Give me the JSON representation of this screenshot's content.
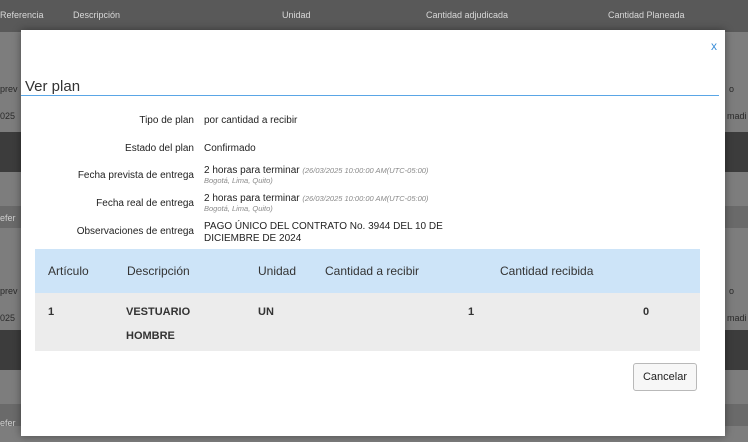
{
  "background": {
    "headers": [
      "Referencia",
      "Descripción",
      "Unidad",
      "Cantidad adjudicada",
      "Cantidad Planeada"
    ],
    "side_left": [
      "prev",
      "025",
      "efer",
      "prev",
      "025",
      "efer"
    ],
    "side_right": [
      "o",
      "madi",
      "o",
      "madi"
    ]
  },
  "modal": {
    "close_label": "x",
    "title": "Ver plan",
    "fields": {
      "plan_type": {
        "label": "Tipo de plan",
        "value": "por cantidad a recibir"
      },
      "plan_state": {
        "label": "Estado del plan",
        "value": "Confirmado"
      },
      "planned_date": {
        "label": "Fecha prevista de entrega",
        "value": "2 horas para terminar",
        "detail": "(26/03/2025 10:00:00 AM(UTC-05:00)",
        "detail2": "Bogotá, Lima, Quito)"
      },
      "real_date": {
        "label": "Fecha real de entrega",
        "value": "2 horas para terminar",
        "detail": "(26/03/2025 10:00:00 AM(UTC-05:00)",
        "detail2": "Bogotá, Lima, Quito)"
      },
      "observations": {
        "label": "Observaciones de entrega",
        "value": "PAGO ÚNICO DEL CONTRATO No. 3944 DEL 10 DE DICIEMBRE DE 2024"
      }
    },
    "table": {
      "headers": [
        "Artículo",
        "Descripción",
        "Unidad",
        "Cantidad a recibir",
        "Cantidad recibida"
      ],
      "rows": [
        {
          "articulo": "1",
          "descripcion_1": "VESTUARIO",
          "descripcion_2": "HOMBRE",
          "unidad": "UN",
          "cantidad_a_recibir": "1",
          "cantidad_recibida": "0"
        }
      ]
    },
    "cancel_label": "Cancelar"
  }
}
